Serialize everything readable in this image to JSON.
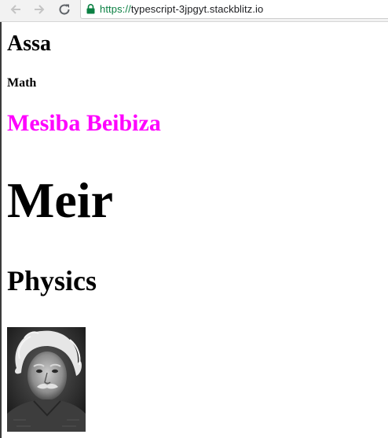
{
  "browser": {
    "url_scheme": "https://",
    "url_host": "typescript-3jpgyt.stackblitz.io"
  },
  "page": {
    "heading_1": "Assa",
    "heading_2": "Math",
    "heading_3": "Mesiba Beibiza",
    "heading_4": "Meir",
    "heading_5": "Physics"
  },
  "colors": {
    "highlight": "#ff00ff",
    "secure_green": "#0b8043"
  },
  "icons": {
    "back": "arrow-left-icon",
    "forward": "arrow-right-icon",
    "reload": "reload-icon",
    "secure": "lock-icon"
  }
}
